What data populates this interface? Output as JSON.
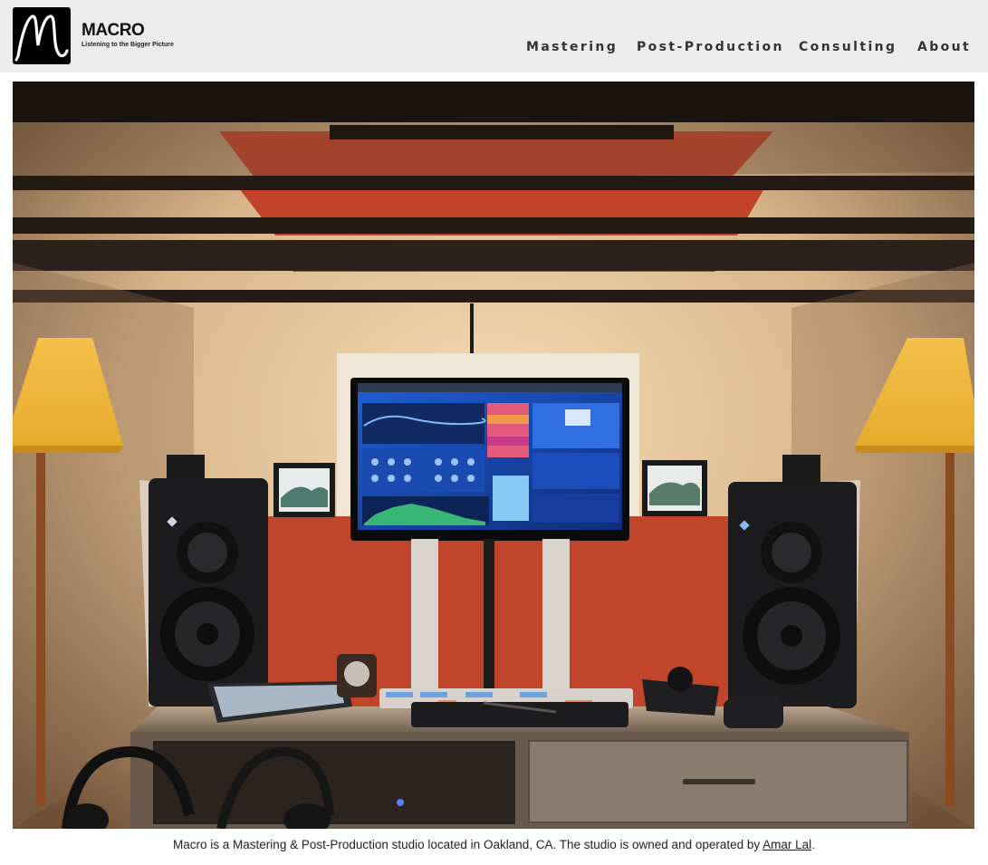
{
  "brand": {
    "name": "MACRO",
    "tagline": "Listening to the Bigger Picture",
    "logo_icon": "macro-m-logo-icon"
  },
  "nav": {
    "items": [
      {
        "label": "Mastering"
      },
      {
        "label": "Post-Production"
      },
      {
        "label": "Consulting"
      },
      {
        "label": "About"
      }
    ]
  },
  "hero": {
    "icon": "studio-photo"
  },
  "caption": {
    "prefix": "Macro is a Mastering & Post-Production studio located in Oakland, CA. The studio is owned and operated by ",
    "link_text": "Amar Lal",
    "suffix": "."
  },
  "colors": {
    "header_bg": "#ececec",
    "text": "#222222",
    "panel_red": "#c8472c",
    "wall_cream": "#e8c9a0"
  }
}
